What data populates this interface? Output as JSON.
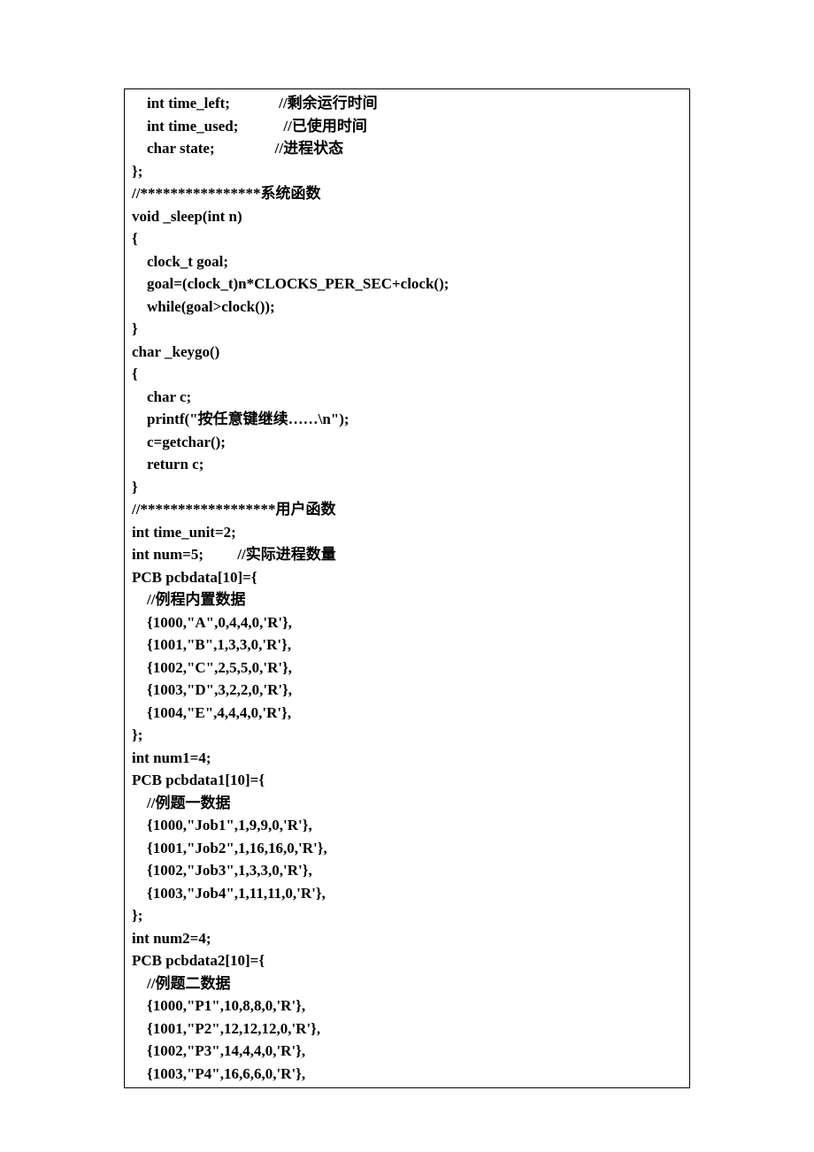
{
  "code": {
    "l1": "    int time_left;             //剩余运行时间",
    "l2": "    int time_used;            //已使用时间",
    "l3": "    char state;                //进程状态",
    "l4": "};",
    "l5": "//****************系统函数",
    "l6": "void _sleep(int n)",
    "l7": "{",
    "l8": "    clock_t goal;",
    "l9": "    goal=(clock_t)n*CLOCKS_PER_SEC+clock();",
    "l10": "    while(goal>clock());",
    "l11": "}",
    "l12": "char _keygo()",
    "l13": "{",
    "l14": "    char c;",
    "l15": "    printf(\"按任意键继续……\\n\");",
    "l16": "    c=getchar();",
    "l17": "    return c;",
    "l18": "}",
    "l19": "//******************用户函数",
    "l20": "int time_unit=2;",
    "l21": "int num=5;         //实际进程数量",
    "l22": "PCB pcbdata[10]={",
    "l23": "    //例程内置数据",
    "l24": "    {1000,\"A\",0,4,4,0,'R'},",
    "l25": "    {1001,\"B\",1,3,3,0,'R'},",
    "l26": "    {1002,\"C\",2,5,5,0,'R'},",
    "l27": "    {1003,\"D\",3,2,2,0,'R'},",
    "l28": "    {1004,\"E\",4,4,4,0,'R'},",
    "l29": "};",
    "l30": "int num1=4;",
    "l31": "PCB pcbdata1[10]={",
    "l32": "    //例题一数据",
    "l33": "    {1000,\"Job1\",1,9,9,0,'R'},",
    "l34": "    {1001,\"Job2\",1,16,16,0,'R'},",
    "l35": "    {1002,\"Job3\",1,3,3,0,'R'},",
    "l36": "    {1003,\"Job4\",1,11,11,0,'R'},",
    "l37": "};",
    "l38": "int num2=4;",
    "l39": "PCB pcbdata2[10]={",
    "l40": "    //例题二数据",
    "l41": "    {1000,\"P1\",10,8,8,0,'R'},",
    "l42": "    {1001,\"P2\",12,12,12,0,'R'},",
    "l43": "    {1002,\"P3\",14,4,4,0,'R'},",
    "l44": "    {1003,\"P4\",16,6,6,0,'R'},"
  }
}
